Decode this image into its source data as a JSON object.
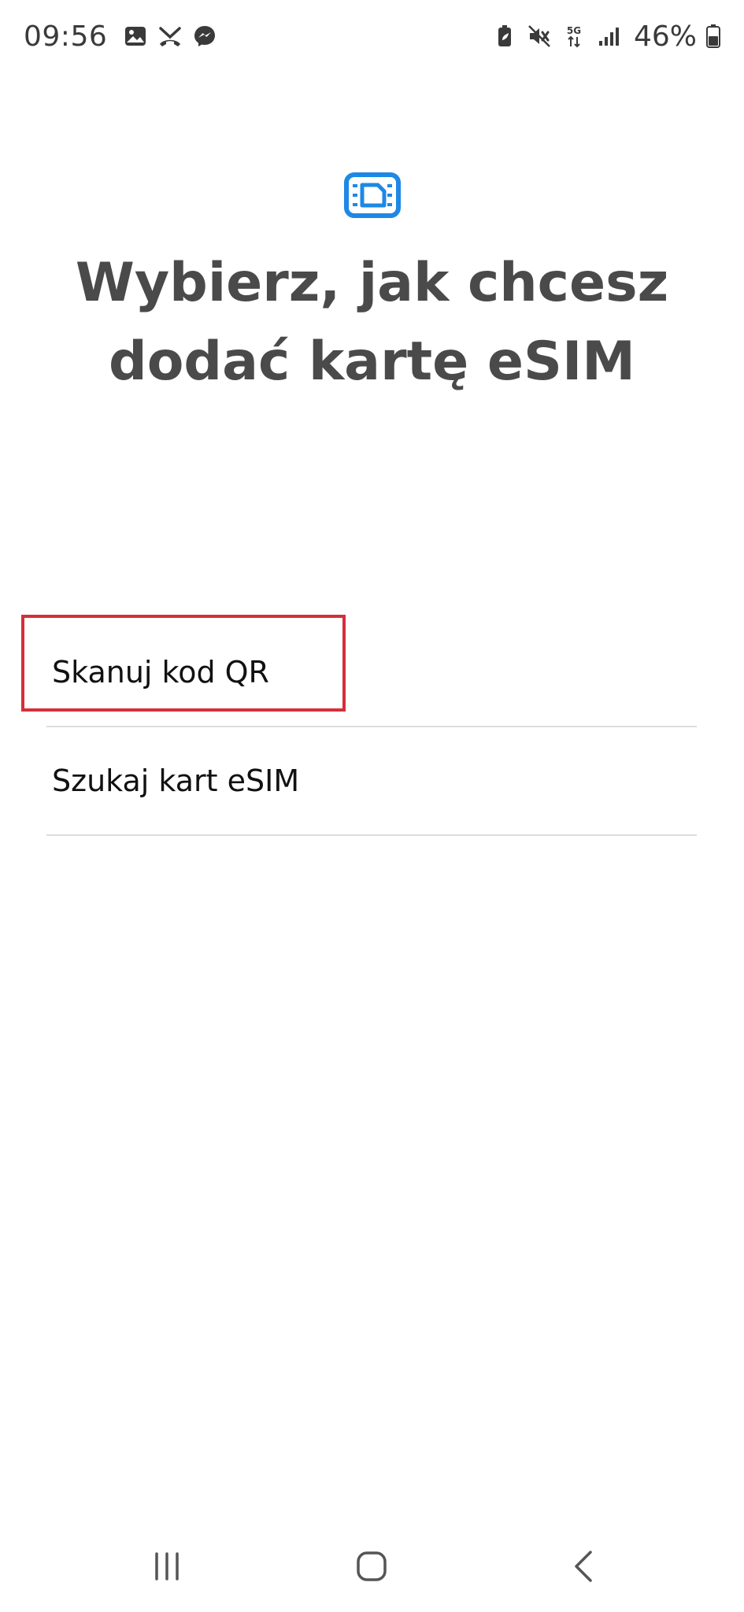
{
  "status_bar": {
    "time": "09:56",
    "battery_percent": "46%",
    "network": "5G",
    "notification_icons": [
      "gallery-icon",
      "missed-call-icon",
      "messenger-icon"
    ],
    "system_icons": [
      "battery-saver-icon",
      "mute-icon",
      "network-5g-icon",
      "signal-icon",
      "battery-icon"
    ]
  },
  "header": {
    "icon": "esim-icon",
    "title": "Wybierz, jak chcesz dodać kartę eSIM"
  },
  "options": [
    {
      "label": "Skanuj kod QR"
    },
    {
      "label": "Szukaj kart eSIM"
    }
  ],
  "navigation": {
    "items": [
      "recent-apps-icon",
      "home-icon",
      "back-icon"
    ]
  },
  "colors": {
    "accent": "#1e88e5",
    "highlight": "#d32f3a",
    "title": "#4a4a4a",
    "divider": "#dcdcdc"
  }
}
